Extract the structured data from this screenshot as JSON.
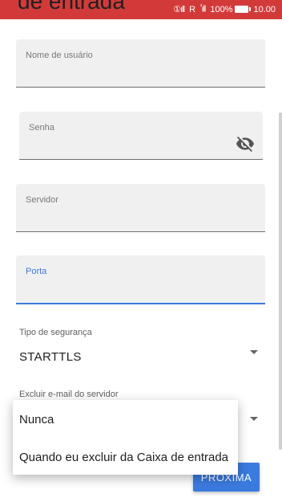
{
  "status_bar": {
    "sim1": "①",
    "signal": "ıll",
    "roaming": "R",
    "sim2": "²",
    "signal2": "ıll",
    "battery": "100%",
    "time": "10.00"
  },
  "heading_partial": "de entrada",
  "fields": {
    "username": {
      "label": "Nome de usuário"
    },
    "password": {
      "label": "Senha"
    },
    "server": {
      "label": "Servidor"
    },
    "port": {
      "label": "Porta"
    }
  },
  "security": {
    "label": "Tipo de segurança",
    "value": "STARTTLS"
  },
  "delete_email": {
    "label": "Excluir e-mail do servidor"
  },
  "dropdown": {
    "options": [
      "Nunca",
      "Quando eu excluir da Caixa de entrada"
    ]
  },
  "next_button": "PRÓXIMA",
  "colors": {
    "status_bar": "#d23a3a",
    "accent": "#3b7be0",
    "field_bg": "#f0f0f0"
  }
}
